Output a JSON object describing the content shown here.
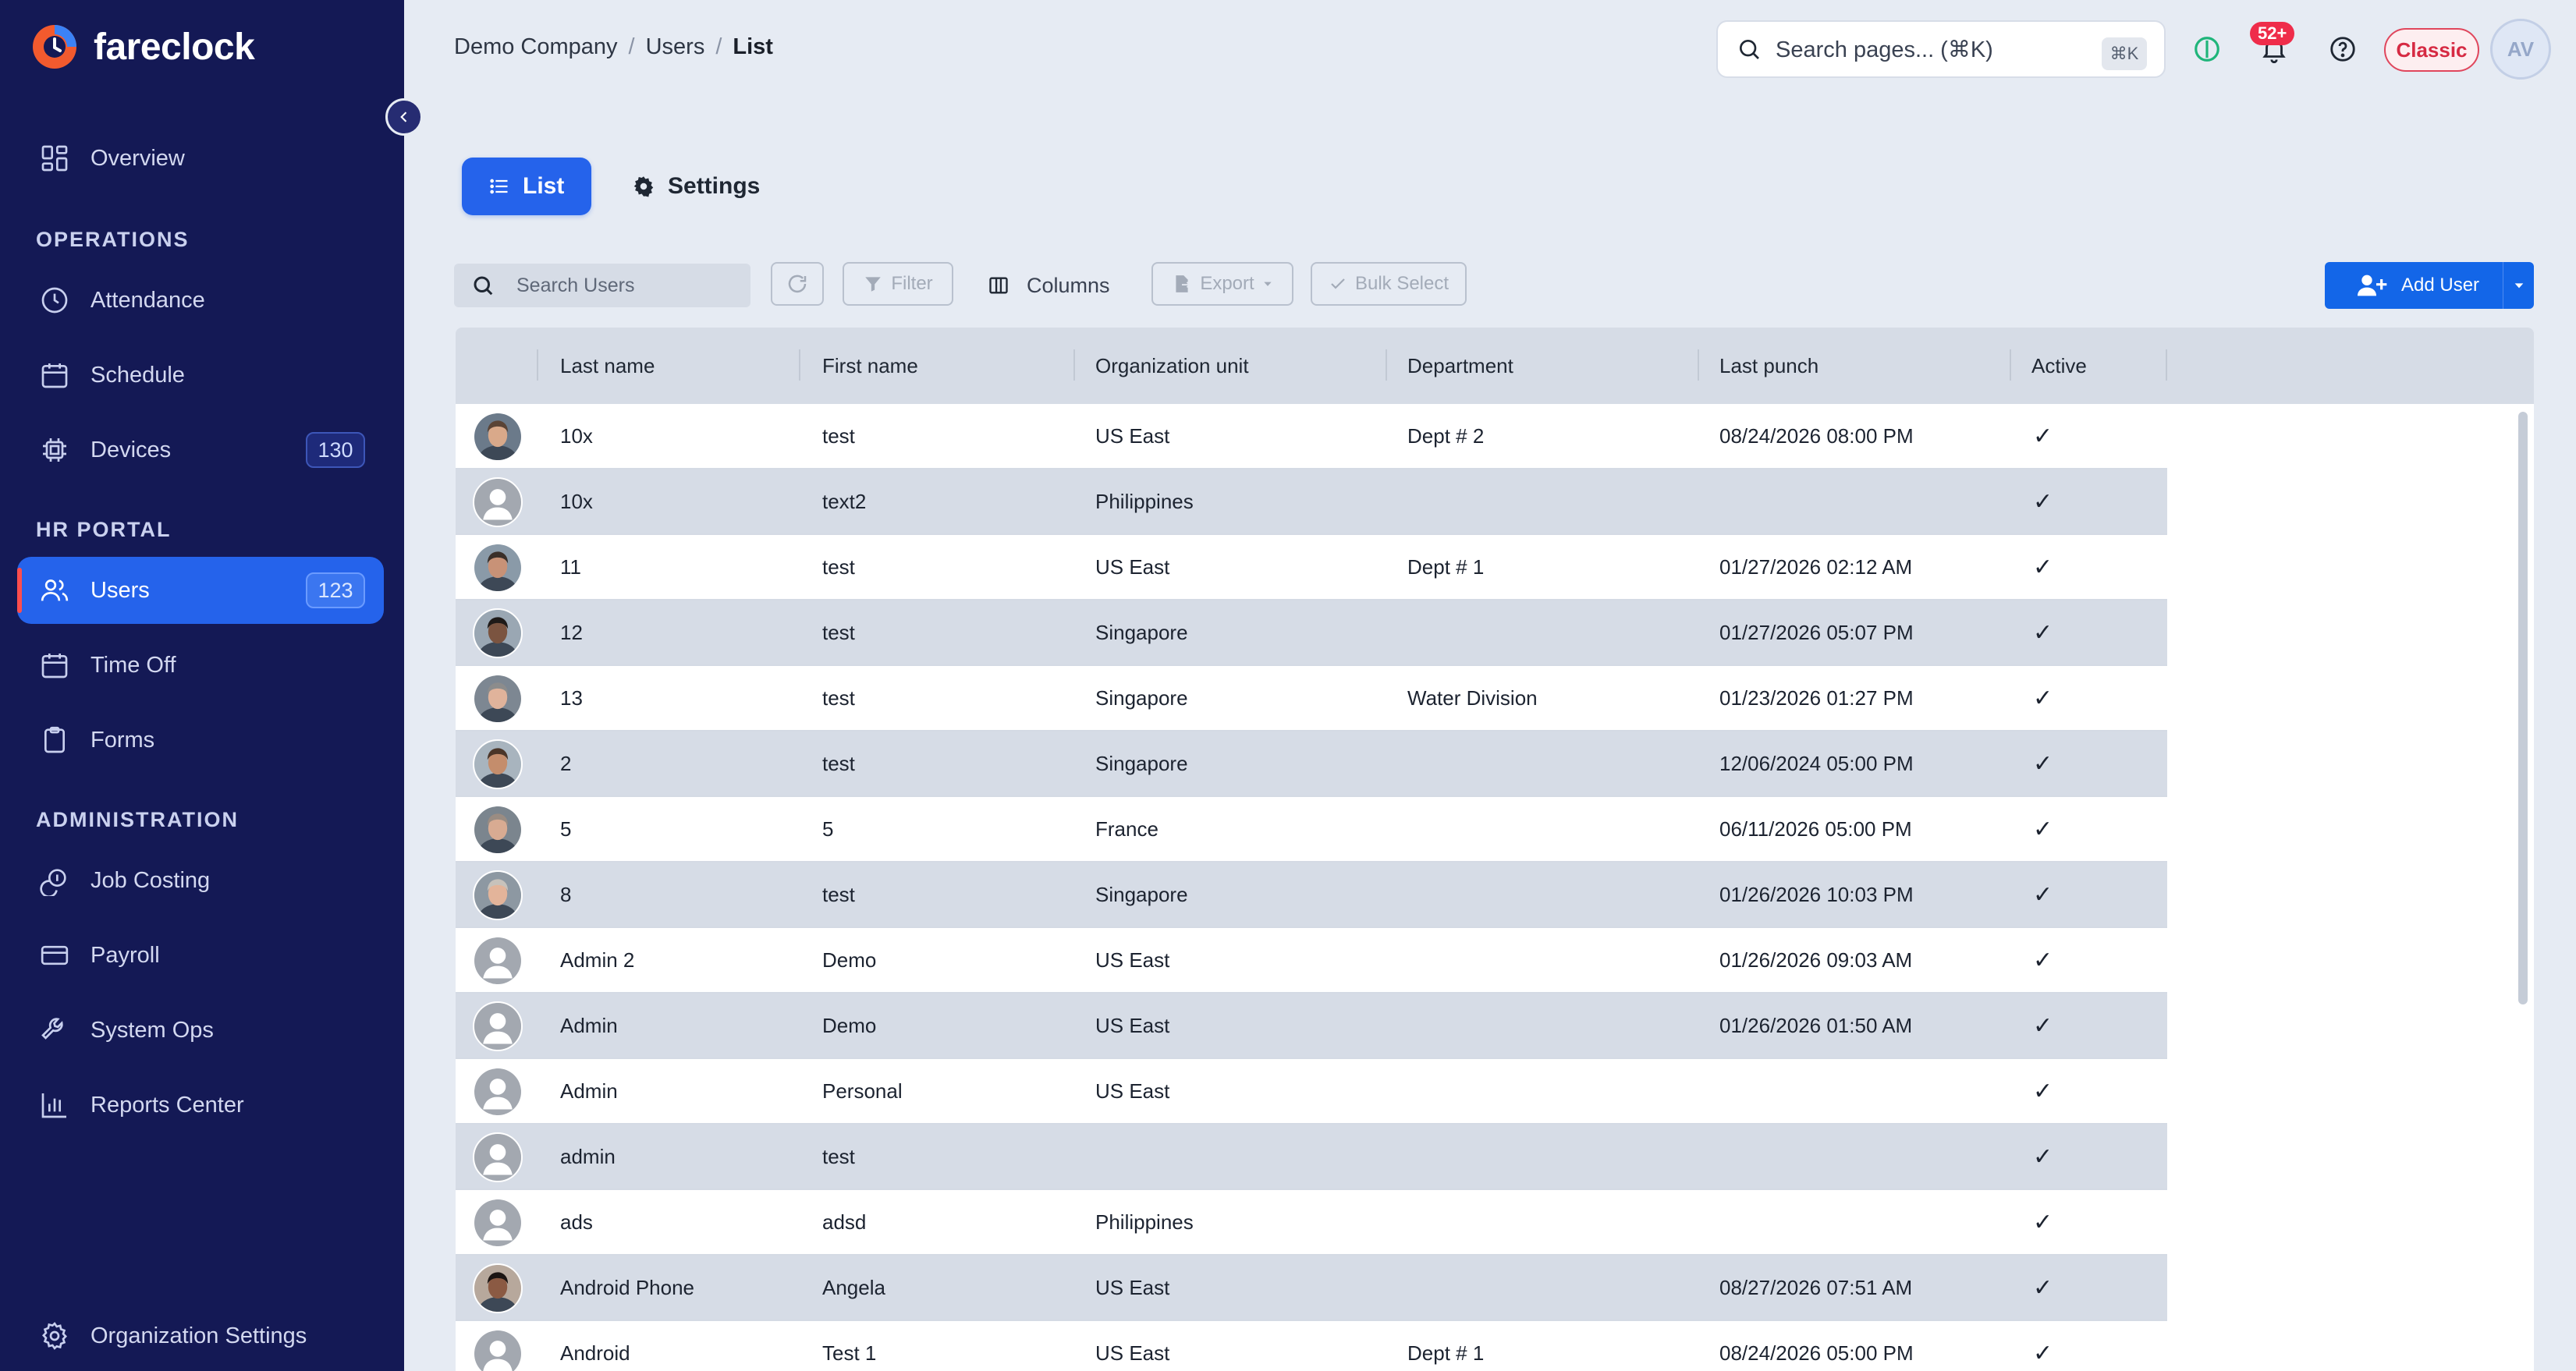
{
  "app": {
    "name": "fareclock"
  },
  "sidebar": {
    "overview": "Overview",
    "sections": {
      "operations": "OPERATIONS",
      "hr_portal": "HR PORTAL",
      "administration": "ADMINISTRATION"
    },
    "items": {
      "attendance": "Attendance",
      "schedule": "Schedule",
      "devices": "Devices",
      "devices_count": "130",
      "users": "Users",
      "users_count": "123",
      "time_off": "Time Off",
      "forms": "Forms",
      "job_costing": "Job Costing",
      "payroll": "Payroll",
      "system_ops": "System Ops",
      "reports_center": "Reports Center"
    },
    "organization_settings": "Organization Settings"
  },
  "header": {
    "breadcrumb": [
      "Demo Company",
      "Users",
      "List"
    ],
    "breadcrumb_sep": "/",
    "search_placeholder": "Search pages... (⌘K)",
    "search_kbd": "⌘K",
    "notifications_count": "52+",
    "classic_label": "Classic",
    "avatar_initials": "AV"
  },
  "tabs": {
    "list": "List",
    "settings": "Settings"
  },
  "toolbar": {
    "search_placeholder": "Search Users",
    "filter": "Filter",
    "columns": "Columns",
    "export": "Export",
    "bulk_select": "Bulk Select",
    "add_user": "Add User"
  },
  "table": {
    "columns": [
      "Last name",
      "First name",
      "Organization unit",
      "Department",
      "Last punch",
      "Active"
    ],
    "rows": [
      {
        "last": "10x",
        "first": "test",
        "org": "US East",
        "dept": "Dept # 2",
        "punch": "08/24/2026 08:00 PM",
        "active": "✓",
        "photo": true
      },
      {
        "last": "10x",
        "first": "text2",
        "org": "Philippines",
        "dept": "",
        "punch": "",
        "active": "✓",
        "photo": false
      },
      {
        "last": "11",
        "first": "test",
        "org": "US East",
        "dept": "Dept # 1",
        "punch": "01/27/2026 02:12 AM",
        "active": "✓",
        "photo": true
      },
      {
        "last": "12",
        "first": "test",
        "org": "Singapore",
        "dept": "",
        "punch": "01/27/2026 05:07 PM",
        "active": "✓",
        "photo": true
      },
      {
        "last": "13",
        "first": "test",
        "org": "Singapore",
        "dept": "Water Division",
        "punch": "01/23/2026 01:27 PM",
        "active": "✓",
        "photo": true
      },
      {
        "last": "2",
        "first": "test",
        "org": "Singapore",
        "dept": "",
        "punch": "12/06/2024 05:00 PM",
        "active": "✓",
        "photo": true
      },
      {
        "last": "5",
        "first": "5",
        "org": "France",
        "dept": "",
        "punch": "06/11/2026 05:00 PM",
        "active": "✓",
        "photo": true
      },
      {
        "last": "8",
        "first": "test",
        "org": "Singapore",
        "dept": "",
        "punch": "01/26/2026 10:03 PM",
        "active": "✓",
        "photo": true
      },
      {
        "last": "Admin 2",
        "first": "Demo",
        "org": "US East",
        "dept": "",
        "punch": "01/26/2026 09:03 AM",
        "active": "✓",
        "photo": false
      },
      {
        "last": "Admin",
        "first": "Demo",
        "org": "US East",
        "dept": "",
        "punch": "01/26/2026 01:50 AM",
        "active": "✓",
        "photo": false
      },
      {
        "last": "Admin",
        "first": "Personal",
        "org": "US East",
        "dept": "",
        "punch": "",
        "active": "✓",
        "photo": false
      },
      {
        "last": "admin",
        "first": "test",
        "org": "",
        "dept": "",
        "punch": "",
        "active": "✓",
        "photo": false
      },
      {
        "last": "ads",
        "first": "adsd",
        "org": "Philippines",
        "dept": "",
        "punch": "",
        "active": "✓",
        "photo": false
      },
      {
        "last": "Android Phone",
        "first": "Angela",
        "org": "US East",
        "dept": "",
        "punch": "08/27/2026 07:51 AM",
        "active": "✓",
        "photo": true
      },
      {
        "last": "Android",
        "first": "Test 1",
        "org": "US East",
        "dept": "Dept # 1",
        "punch": "08/24/2026 05:00 PM",
        "active": "✓",
        "photo": false
      }
    ]
  },
  "colors": {
    "sidebar_bg": "#141955",
    "accent": "#2563eb",
    "notification": "#ef2c4a",
    "classic": "#d62a43",
    "row_alt": "#d6dce6"
  }
}
